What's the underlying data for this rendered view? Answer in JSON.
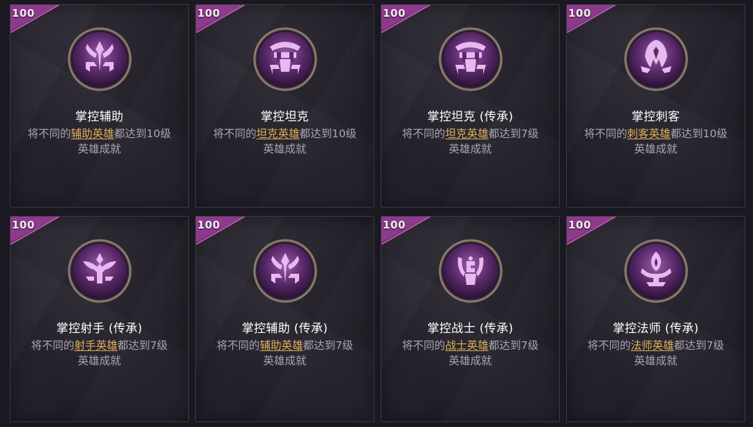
{
  "colors": {
    "badge_purple": "#7a2f7a",
    "emblem_glow": "#d9a0e6",
    "emblem_core": "#5a2a6a",
    "ring_gold": "#8c7a6a",
    "title": "#ffffff",
    "desc": "#a9a7b0",
    "highlight": "#e0b25a"
  },
  "cards": [
    {
      "badge": "100",
      "icon": "support-emblem",
      "title": "掌控辅助",
      "desc_pre": "将不同的",
      "desc_link": "辅助英雄",
      "desc_post": "都达到10级",
      "category": "英雄成就"
    },
    {
      "badge": "100",
      "icon": "tank-emblem",
      "title": "掌控坦克",
      "desc_pre": "将不同的",
      "desc_link": "坦克英雄",
      "desc_post": "都达到10级",
      "category": "英雄成就"
    },
    {
      "badge": "100",
      "icon": "tank-emblem",
      "title": "掌控坦克 (传承)",
      "desc_pre": "将不同的",
      "desc_link": "坦克英雄",
      "desc_post": "都达到7级",
      "category": "英雄成就"
    },
    {
      "badge": "100",
      "icon": "assassin-emblem",
      "title": "掌控刺客",
      "desc_pre": "将不同的",
      "desc_link": "刺客英雄",
      "desc_post": "都达到10级",
      "category": "英雄成就"
    },
    {
      "badge": "100",
      "icon": "marksman-emblem",
      "title": "掌控射手 (传承)",
      "desc_pre": "将不同的",
      "desc_link": "射手英雄",
      "desc_post": "都达到7级",
      "category": "英雄成就"
    },
    {
      "badge": "100",
      "icon": "support-emblem",
      "title": "掌控辅助 (传承)",
      "desc_pre": "将不同的",
      "desc_link": "辅助英雄",
      "desc_post": "都达到7级",
      "category": "英雄成就"
    },
    {
      "badge": "100",
      "icon": "fighter-emblem",
      "title": "掌控战士 (传承)",
      "desc_pre": "将不同的",
      "desc_link": "战士英雄",
      "desc_post": "都达到7级",
      "category": "英雄成就"
    },
    {
      "badge": "100",
      "icon": "mage-emblem",
      "title": "掌控法师 (传承)",
      "desc_pre": "将不同的",
      "desc_link": "法师英雄",
      "desc_post": "都达到7级",
      "category": "英雄成就"
    }
  ]
}
